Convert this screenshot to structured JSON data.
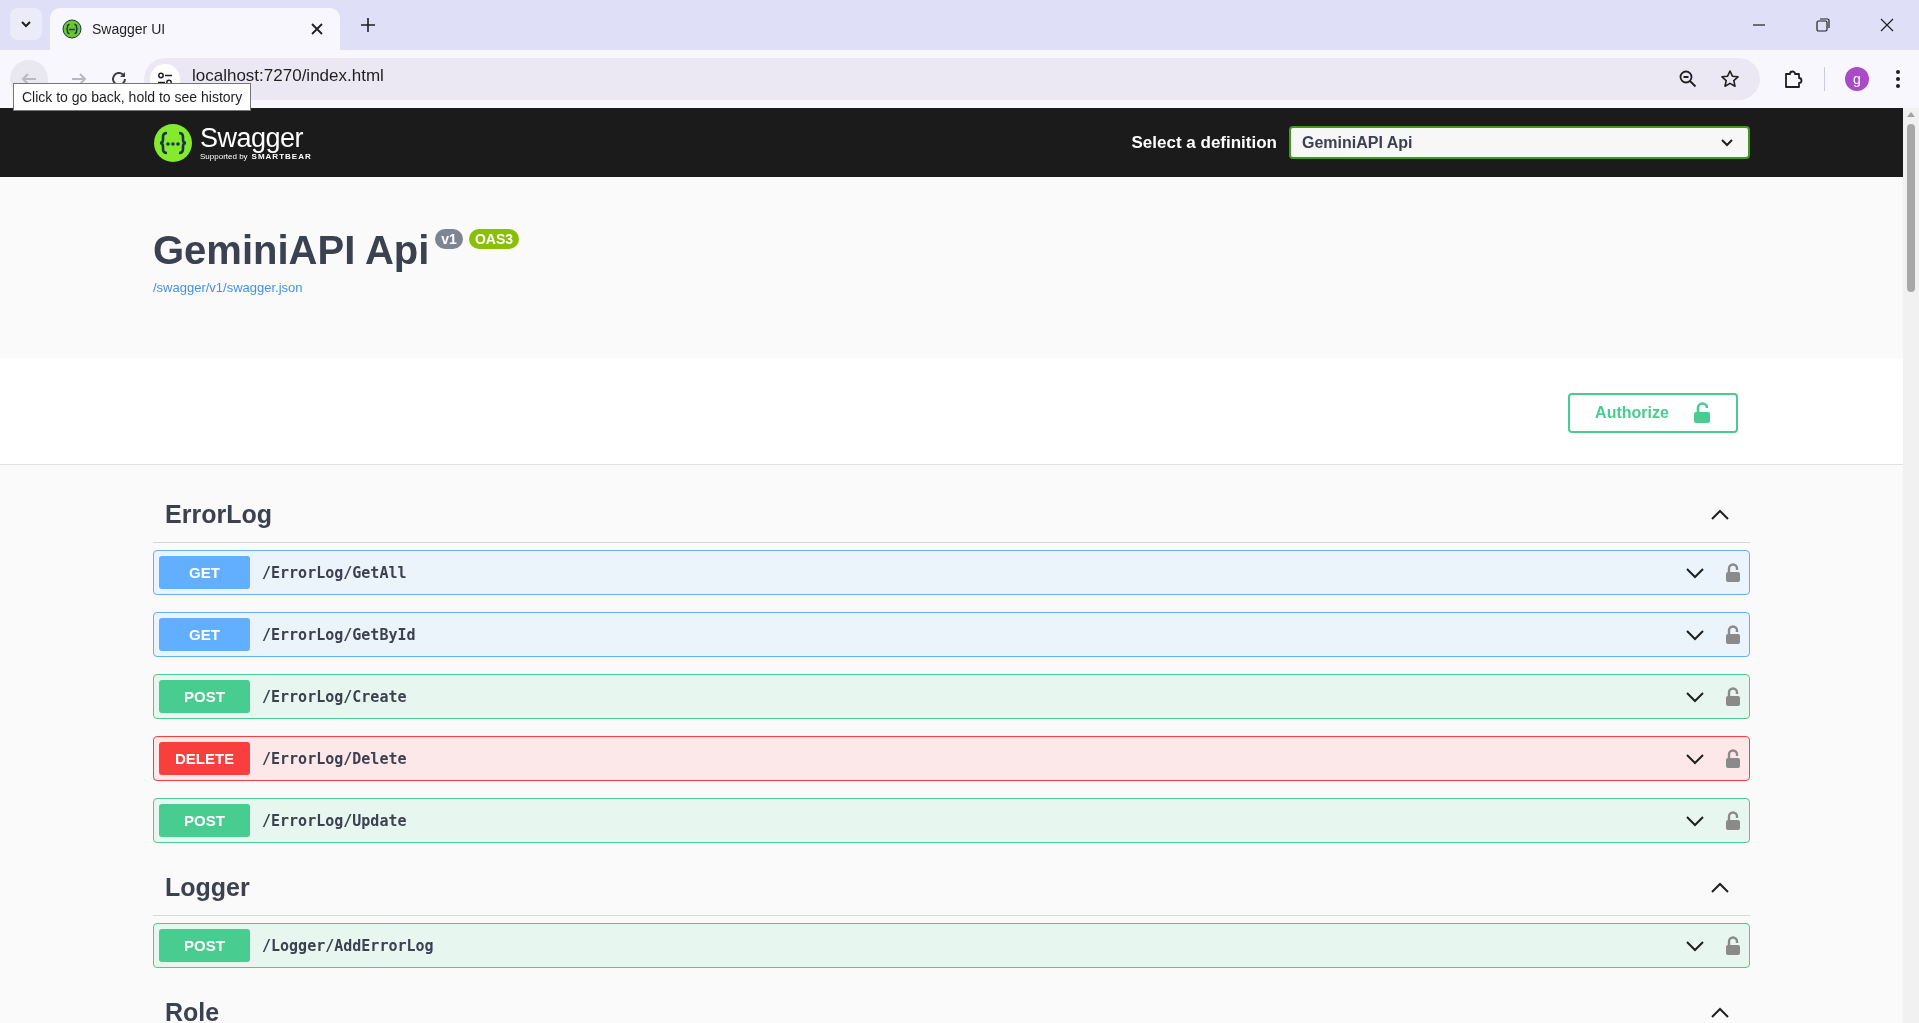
{
  "browser": {
    "tabs": [
      {
        "title": "Swagger UI",
        "selected": true
      }
    ],
    "address": "localhost:7270/index.html",
    "tooltip": "Click to go back, hold to see history",
    "profile_initial": "g"
  },
  "topbar": {
    "brand": "Swagger",
    "supported_by": "Supported by",
    "company": "SMARTBEAR",
    "definition_label": "Select a definition",
    "definition_value": "GeminiAPI Api"
  },
  "info": {
    "title": "GeminiAPI Api",
    "version": "v1",
    "spec": "OAS3",
    "link": "/swagger/v1/swagger.json"
  },
  "authorize": {
    "label": "Authorize"
  },
  "sections": [
    {
      "name": "ErrorLog",
      "expanded": true,
      "operations": [
        {
          "kind": "get",
          "method": "GET",
          "path": "/ErrorLog/GetAll",
          "expanded": false
        },
        {
          "kind": "get",
          "method": "GET",
          "path": "/ErrorLog/GetById",
          "expanded": false
        },
        {
          "kind": "post",
          "method": "POST",
          "path": "/ErrorLog/Create",
          "expanded": false
        },
        {
          "kind": "delete",
          "method": "DELETE",
          "path": "/ErrorLog/Delete",
          "expanded": false
        },
        {
          "kind": "post",
          "method": "POST",
          "path": "/ErrorLog/Update",
          "expanded": false
        }
      ]
    },
    {
      "name": "Logger",
      "expanded": true,
      "operations": [
        {
          "kind": "post",
          "method": "POST",
          "path": "/Logger/AddErrorLog",
          "expanded": false
        }
      ]
    },
    {
      "name": "Role",
      "expanded": true
    }
  ]
}
